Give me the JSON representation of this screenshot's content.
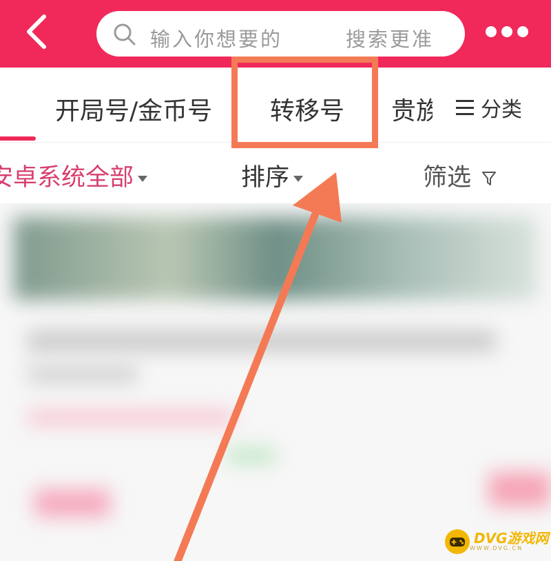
{
  "header": {
    "search_placeholder_1": "输入你想要的",
    "search_placeholder_2": "搜索更准"
  },
  "tabs": [
    {
      "label": "开局号/金币号"
    },
    {
      "label": "转移号"
    },
    {
      "label": "贵族"
    }
  ],
  "category": {
    "label": "分类"
  },
  "filters": {
    "system": "安卓系统全部",
    "sort": "排序",
    "filter": "筛选"
  },
  "colors": {
    "brand": "#f0295a",
    "highlight": "#f47a55",
    "watermark": "#f2b705"
  },
  "watermark": {
    "title": "DVG游戏网",
    "sub": "WWW.DVG.CN"
  }
}
